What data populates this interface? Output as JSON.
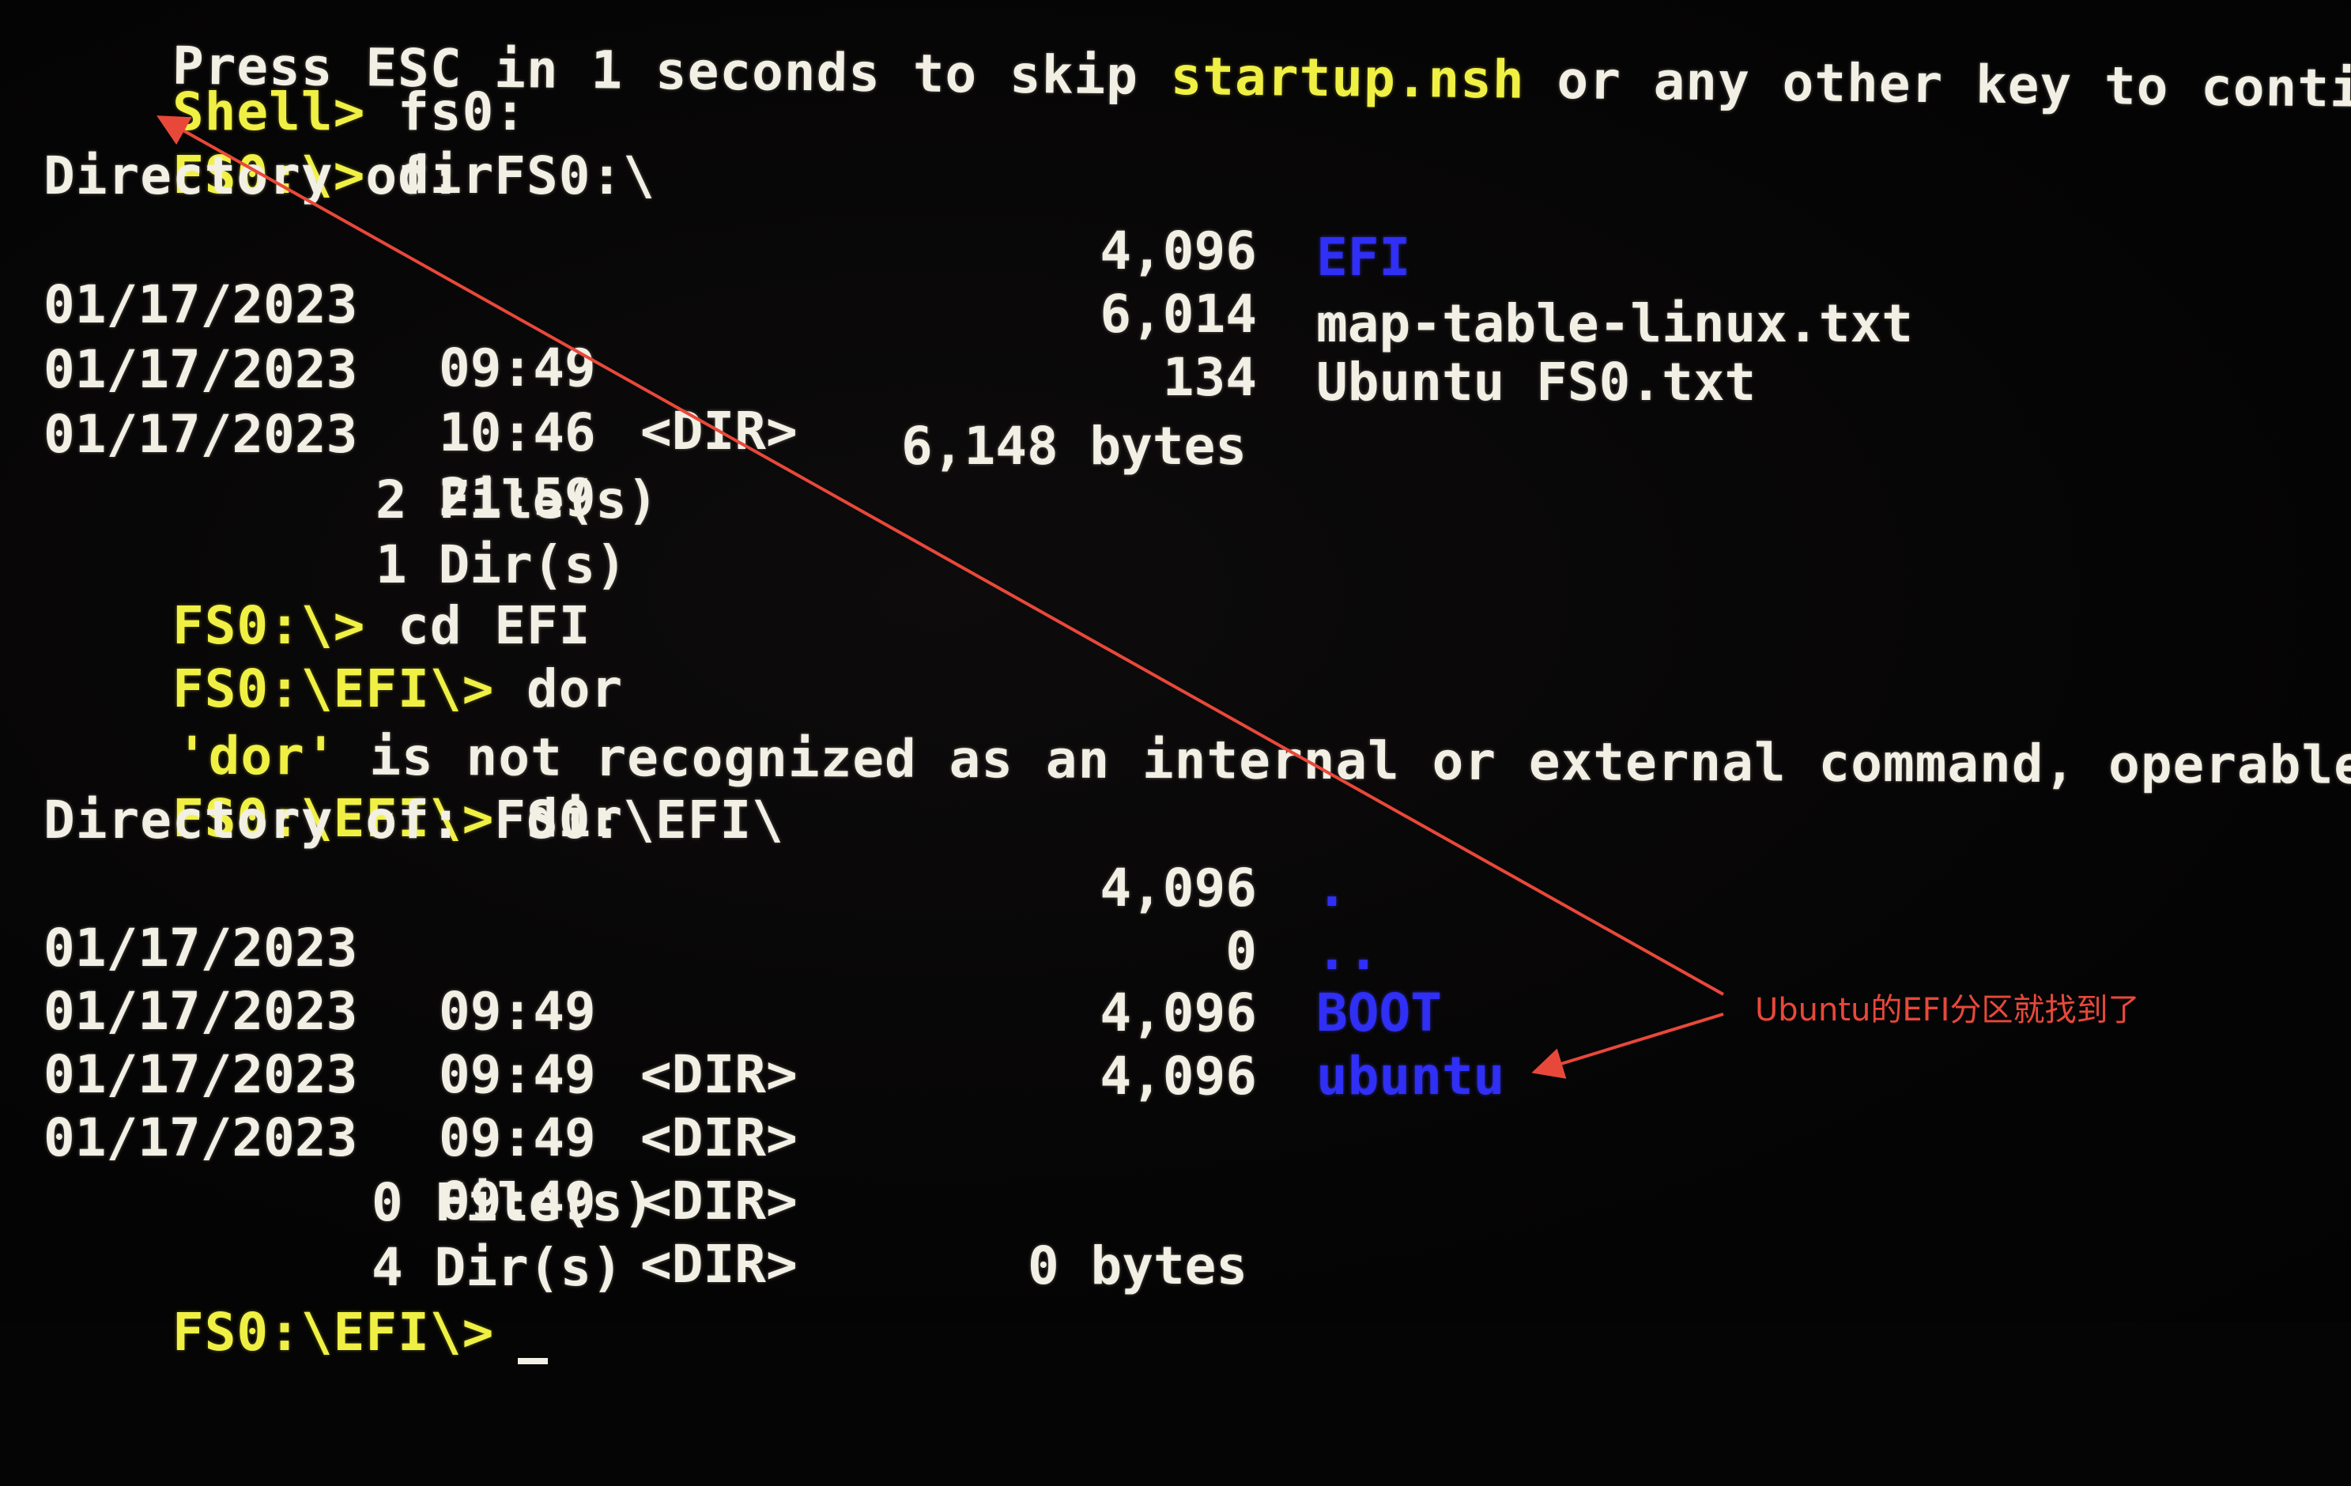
{
  "terminal": {
    "header_line": {
      "prefix": "Press ESC in 1 seconds to skip ",
      "highlight": "startup.nsh",
      "suffix": " or any other key to continue."
    },
    "session1": {
      "prompt": "Shell>",
      "command": " fs0:"
    },
    "session2": {
      "prompt": "FS0:\\>",
      "command": " dir"
    },
    "listing1": {
      "header": "Directory of: FS0:\\",
      "entries": [
        {
          "date": "01/17/2023",
          "time": "09:49",
          "type": "<DIR>",
          "size": "4,096",
          "name": "EFI",
          "is_dir": true
        },
        {
          "date": "01/17/2023",
          "time": "10:46",
          "type": "",
          "size": "6,014",
          "name": "map-table-linux.txt",
          "is_dir": false
        },
        {
          "date": "01/17/2023",
          "time": "21:59",
          "type": "",
          "size": "134",
          "name": "Ubuntu FS0.txt",
          "is_dir": false
        }
      ],
      "files_summary": "2 File(s)",
      "bytes_summary": "6,148 bytes",
      "dirs_summary": "1 Dir(s)"
    },
    "session3": {
      "prompt": "FS0:\\>",
      "command": " cd EFI"
    },
    "session4": {
      "prompt": "FS0:\\EFI\\>",
      "command": " dor"
    },
    "error": {
      "quoted": "'dor'",
      "message": " is not recognized as an internal or external command, operable program"
    },
    "session5": {
      "prompt": "FS0:\\EFI\\>",
      "command": " dir"
    },
    "listing2": {
      "header": "Directory of: FS0:\\EFI\\",
      "entries": [
        {
          "date": "01/17/2023",
          "time": "09:49",
          "type": "<DIR>",
          "size": "4,096",
          "name": ".",
          "is_dir": true
        },
        {
          "date": "01/17/2023",
          "time": "09:49",
          "type": "<DIR>",
          "size": "0",
          "name": "..",
          "is_dir": true
        },
        {
          "date": "01/17/2023",
          "time": "09:49",
          "type": "<DIR>",
          "size": "4,096",
          "name": "BOOT",
          "is_dir": true
        },
        {
          "date": "01/17/2023",
          "time": "09:49",
          "type": "<DIR>",
          "size": "4,096",
          "name": "ubuntu",
          "is_dir": true
        }
      ],
      "files_summary": "0 File(s)",
      "bytes_summary": "0 bytes",
      "dirs_summary": "4 Dir(s)"
    },
    "final_prompt": "FS0:\\EFI\\>"
  },
  "annotation": {
    "label": "Ubuntu的EFI分区就找到了",
    "color": "#e8483a"
  },
  "colors": {
    "prompt": "#f0f044",
    "text": "#f2efe4",
    "directory": "#2f2ff5",
    "background": "#050505"
  }
}
